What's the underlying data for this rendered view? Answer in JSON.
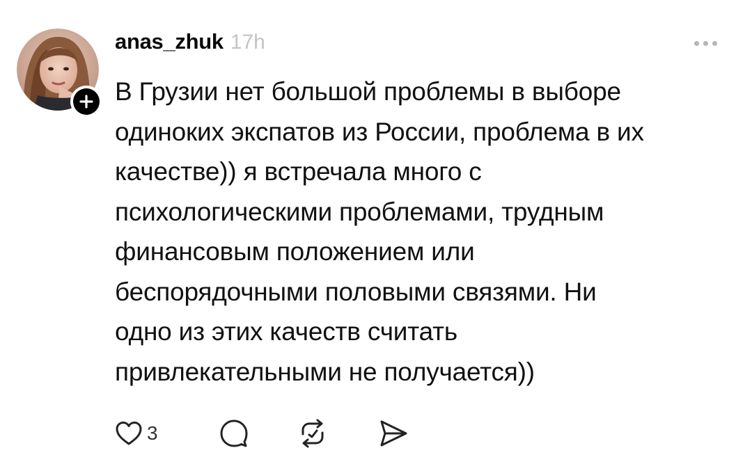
{
  "post": {
    "author": {
      "username": "anas_zhuk",
      "timestamp": "17h",
      "avatar_icon": "user-photo-avatar",
      "follow_icon": "plus-icon"
    },
    "more_icon": "more-dots-icon",
    "text_lines": [
      "В Грузии нет большой проблемы в выборе",
      "одиноких экспатов из России, проблема в их",
      "качестве)) я встречала много с",
      "психологическими проблемами, трудным",
      "финансовым положением или",
      "беспорядочными половыми связями. Ни",
      "одно из этих качеств считать",
      "привлекательными не получается))"
    ],
    "actions": {
      "like_icon": "heart-icon",
      "like_count": "3",
      "reply_icon": "comment-icon",
      "repost_icon": "repost-icon",
      "share_icon": "send-icon"
    }
  },
  "colors": {
    "text": "#111111",
    "muted": "#c4c4c4",
    "icon": "#222222",
    "badge": "#000000"
  }
}
